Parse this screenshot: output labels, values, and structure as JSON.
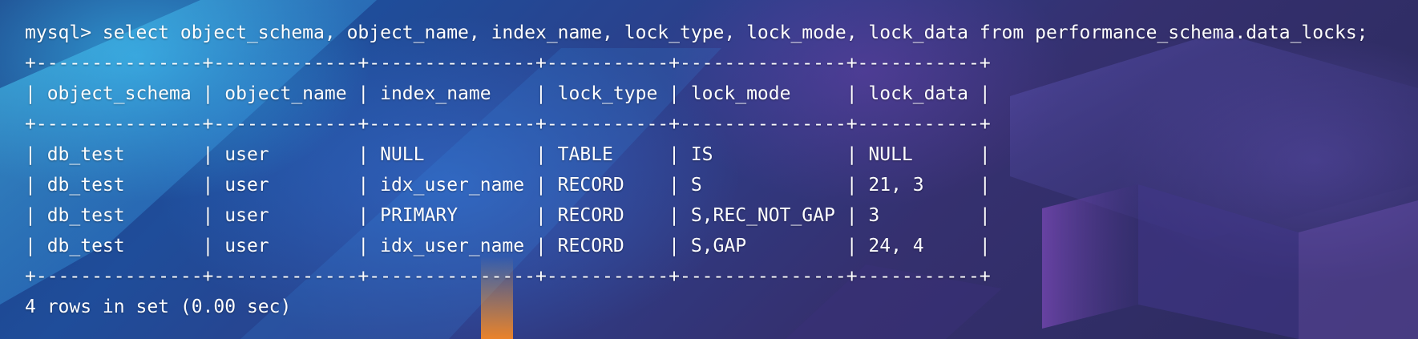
{
  "terminal": {
    "command_line": "mysql> select object_schema, object_name, index_name, lock_type, lock_mode, lock_data from performance_schema.data_locks;",
    "border_line_1": "+---------------+-------------+---------------+-----------+---------------+-----------+",
    "header_line": "| object_schema | object_name | index_name    | lock_type | lock_mode     | lock_data |",
    "border_line_2": "+---------------+-------------+---------------+-----------+---------------+-----------+",
    "rows": [
      "| db_test       | user        | NULL          | TABLE     | IS            | NULL      |",
      "| db_test       | user        | idx_user_name | RECORD    | S             | 21, 3     |",
      "| db_test       | user        | PRIMARY       | RECORD    | S,REC_NOT_GAP | 3         |",
      "| db_test       | user        | idx_user_name | RECORD    | S,GAP         | 24, 4     |"
    ],
    "border_line_3": "+---------------+-------------+---------------+-----------+---------------+-----------+",
    "result_summary": "4 rows in set (0.00 sec)"
  },
  "colors": {
    "text": "#ffffff",
    "background_primary": "#2a2550",
    "accent_cyan": "#3ed2ff",
    "accent_orange": "#f08a2a"
  }
}
